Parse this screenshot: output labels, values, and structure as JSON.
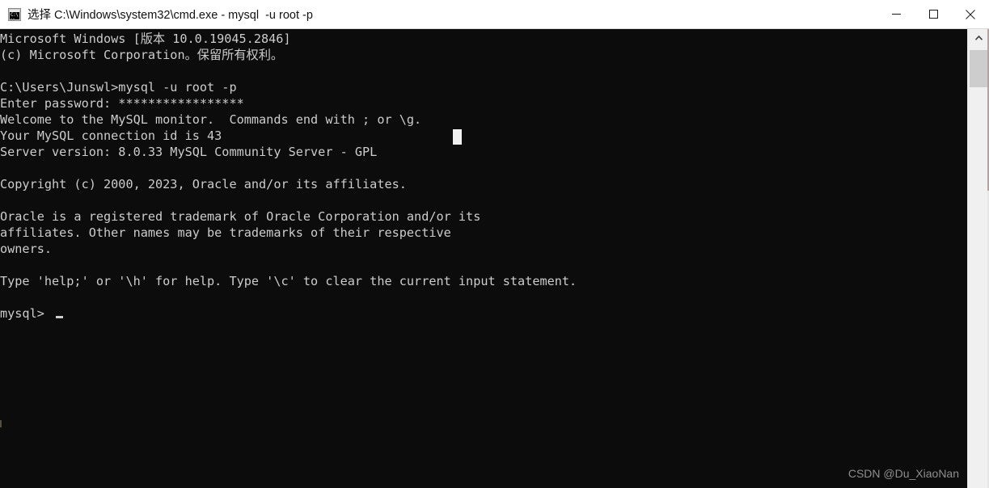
{
  "window": {
    "title": "选择 C:\\Windows\\system32\\cmd.exe - mysql  -u root -p",
    "icon": "cmd-console-icon",
    "icon_prompt": "C:\\",
    "titlebar_bg": "#ffffff",
    "terminal_bg": "#0c0c0c",
    "terminal_fg": "#cccccc"
  },
  "controls": {
    "minimize_label": "Minimize",
    "maximize_label": "Maximize",
    "close_label": "Close"
  },
  "terminal": {
    "content": "Microsoft Windows [版本 10.0.19045.2846]\n(c) Microsoft Corporation。保留所有权利。\n\nC:\\Users\\Junswl>mysql -u root -p\nEnter password: *****************\nWelcome to the MySQL monitor.  Commands end with ; or \\g.\nYour MySQL connection id is 43\nServer version: 8.0.33 MySQL Community Server - GPL\n\nCopyright (c) 2000, 2023, Oracle and/or its affiliates.\n\nOracle is a registered trademark of Oracle Corporation and/or its\naffiliates. Other names may be trademarks of their respective\nowners.\n\nType 'help;' or '\\h' for help. Type '\\c' to clear the current input statement.\n\nmysql> ",
    "lines": [
      "Microsoft Windows [版本 10.0.19045.2846]",
      "(c) Microsoft Corporation。保留所有权利。",
      "",
      "C:\\Users\\Junswl>mysql -u root -p",
      "Enter password: *****************",
      "Welcome to the MySQL monitor.  Commands end with ; or \\g.",
      "Your MySQL connection id is 43",
      "Server version: 8.0.33 MySQL Community Server - GPL",
      "",
      "Copyright (c) 2000, 2023, Oracle and/or its affiliates.",
      "",
      "Oracle is a registered trademark of Oracle Corporation and/or its",
      "affiliates. Other names may be trademarks of their respective",
      "owners.",
      "",
      "Type 'help;' or '\\h' for help. Type '\\c' to clear the current input statement.",
      "",
      "mysql> "
    ],
    "os_name": "Microsoft Windows",
    "os_version": "10.0.19045.2846",
    "copyright_ms": "(c) Microsoft Corporation。保留所有权利。",
    "command": "mysql -u root -p",
    "prompt_path": "C:\\Users\\Junswl>",
    "password_prompt": "Enter password:",
    "password_masked": "*****************",
    "connection_id": "43",
    "server_version": "8.0.33 MySQL Community Server - GPL",
    "mysql_prompt": "mysql>",
    "cursor": "block-cursor"
  },
  "scrollbar": {
    "up_arrow": "chevron-up-icon",
    "thumb_position_pct": 0,
    "visible": true
  },
  "watermark": {
    "text": "CSDN @Du_XiaoNan"
  }
}
